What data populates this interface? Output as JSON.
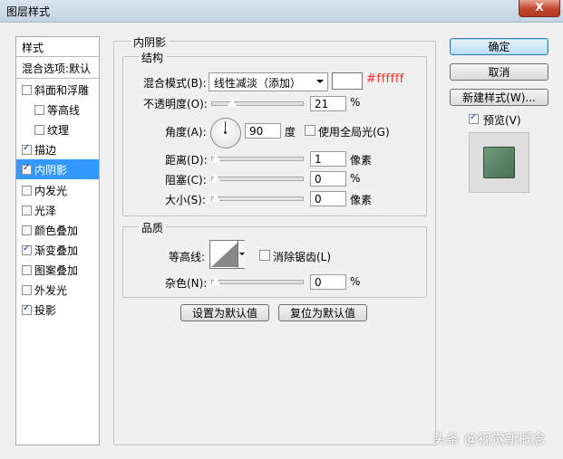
{
  "window": {
    "title": "图层样式",
    "close_label": "X"
  },
  "left_panel": {
    "header": "样式",
    "blend_options": "混合选项:默认",
    "items": [
      {
        "label": "斜面和浮雕",
        "checked": false,
        "indent": false,
        "selected": false
      },
      {
        "label": "等高线",
        "checked": false,
        "indent": true,
        "selected": false
      },
      {
        "label": "纹理",
        "checked": false,
        "indent": true,
        "selected": false
      },
      {
        "label": "描边",
        "checked": true,
        "indent": false,
        "selected": false
      },
      {
        "label": "内阴影",
        "checked": true,
        "indent": false,
        "selected": true
      },
      {
        "label": "内发光",
        "checked": false,
        "indent": false,
        "selected": false
      },
      {
        "label": "光泽",
        "checked": false,
        "indent": false,
        "selected": false
      },
      {
        "label": "颜色叠加",
        "checked": false,
        "indent": false,
        "selected": false
      },
      {
        "label": "渐变叠加",
        "checked": true,
        "indent": false,
        "selected": false
      },
      {
        "label": "图案叠加",
        "checked": false,
        "indent": false,
        "selected": false
      },
      {
        "label": "外发光",
        "checked": false,
        "indent": false,
        "selected": false
      },
      {
        "label": "投影",
        "checked": true,
        "indent": false,
        "selected": false
      }
    ]
  },
  "inner_shadow": {
    "section_title": "内阴影",
    "structure": {
      "title": "结构",
      "blend_mode_label": "混合模式(B):",
      "blend_mode_value": "线性减淡（添加）",
      "color_hex": "#ffffff",
      "color_annotation": "#ffffff",
      "opacity_label": "不透明度(O):",
      "opacity_value": "21",
      "opacity_unit": "%",
      "angle_label": "角度(A):",
      "angle_value": "90",
      "angle_unit": "度",
      "global_light_label": "使用全局光(G)",
      "global_light_checked": false,
      "distance_label": "距离(D):",
      "distance_value": "1",
      "distance_unit": "像素",
      "choke_label": "阻塞(C):",
      "choke_value": "0",
      "choke_unit": "%",
      "size_label": "大小(S):",
      "size_value": "0",
      "size_unit": "像素"
    },
    "quality": {
      "title": "品质",
      "contour_label": "等高线:",
      "anti_alias_label": "消除锯齿(L)",
      "anti_alias_checked": false,
      "noise_label": "杂色(N):",
      "noise_value": "0",
      "noise_unit": "%"
    },
    "make_default_label": "设置为默认值",
    "reset_default_label": "复位为默认值"
  },
  "right_panel": {
    "ok_label": "确定",
    "cancel_label": "取消",
    "new_style_label": "新建样式(W)...",
    "preview_label": "预览(V)",
    "preview_checked": true
  },
  "watermark": "头条 @视觉新概念",
  "colors": {
    "accent": "#3399ff",
    "annotation": "#ff2a2a",
    "preview": "#5a8a67"
  }
}
